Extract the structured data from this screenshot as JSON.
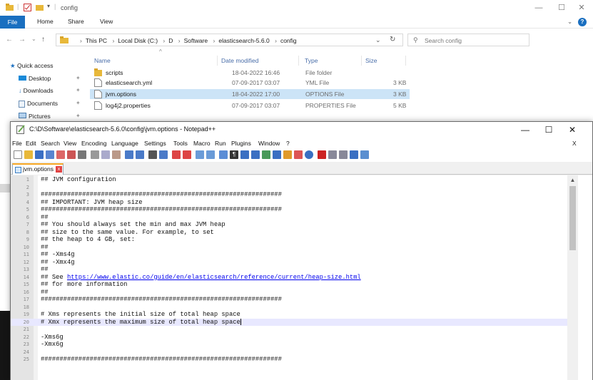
{
  "explorer": {
    "title": "config",
    "ribbon_tabs": [
      "File",
      "Home",
      "Share",
      "View"
    ],
    "breadcrumbs": [
      "This PC",
      "Local Disk (C:)",
      "D",
      "Software",
      "elasticsearch-5.6.0",
      "config"
    ],
    "search_placeholder": "Search config",
    "nav_items": [
      {
        "label": "Quick access",
        "icon": "star-icon"
      },
      {
        "label": "Desktop",
        "icon": "desktop-icon"
      },
      {
        "label": "Downloads",
        "icon": "download-icon"
      },
      {
        "label": "Documents",
        "icon": "documents-icon"
      },
      {
        "label": "Pictures",
        "icon": "pictures-icon"
      }
    ],
    "columns": [
      "Name",
      "Date modified",
      "Type",
      "Size"
    ],
    "files": [
      {
        "name": "scripts",
        "date": "18-04-2022 16:46",
        "type": "File folder",
        "size": "",
        "icon": "folder-icon"
      },
      {
        "name": "elasticsearch.yml",
        "date": "07-09-2017 03:07",
        "type": "YML File",
        "size": "3 KB",
        "icon": "file-icon"
      },
      {
        "name": "jvm.options",
        "date": "18-04-2022 17:00",
        "type": "OPTIONS File",
        "size": "3 KB",
        "icon": "file-icon",
        "selected": true
      },
      {
        "name": "log4j2.properties",
        "date": "07-09-2017 03:07",
        "type": "PROPERTIES File",
        "size": "5 KB",
        "icon": "file-icon"
      }
    ]
  },
  "npp": {
    "title": "C:\\D\\Software\\elasticsearch-5.6.0\\config\\jvm.options - Notepad++",
    "menu": [
      "File",
      "Edit",
      "Search",
      "View",
      "Encoding",
      "Language",
      "Settings",
      "Tools",
      "Macro",
      "Run",
      "Plugins",
      "Window",
      "?"
    ],
    "menu_close": "X",
    "tab_label": "jvm.options",
    "tab_close": "x",
    "link_text": "https://www.elastic.co/guide/en/elasticsearch/reference/current/heap-size.html",
    "lines": [
      {
        "n": "1",
        "text": "## JVM configuration"
      },
      {
        "n": "2",
        "text": ""
      },
      {
        "n": "3",
        "text": "################################################################"
      },
      {
        "n": "4",
        "text": "## IMPORTANT: JVM heap size"
      },
      {
        "n": "5",
        "text": "################################################################"
      },
      {
        "n": "6",
        "text": "##"
      },
      {
        "n": "7",
        "text": "## You should always set the min and max JVM heap"
      },
      {
        "n": "8",
        "text": "## size to the same value. For example, to set"
      },
      {
        "n": "9",
        "text": "## the heap to 4 GB, set:"
      },
      {
        "n": "10",
        "text": "##"
      },
      {
        "n": "11",
        "text": "## -Xms4g"
      },
      {
        "n": "12",
        "text": "## -Xmx4g"
      },
      {
        "n": "13",
        "text": "##"
      },
      {
        "n": "14",
        "text": "## See "
      },
      {
        "n": "15",
        "text": "## for more information"
      },
      {
        "n": "16",
        "text": "##"
      },
      {
        "n": "17",
        "text": "################################################################"
      },
      {
        "n": "18",
        "text": ""
      },
      {
        "n": "19",
        "text": "# Xms represents the initial size of total heap space"
      },
      {
        "n": "20",
        "text": "# Xmx represents the maximum size of total heap space"
      },
      {
        "n": "21",
        "text": ""
      },
      {
        "n": "22",
        "text": "-Xms6g"
      },
      {
        "n": "23",
        "text": "-Xmx6g"
      },
      {
        "n": "24",
        "text": ""
      },
      {
        "n": "25",
        "text": "################################################################"
      }
    ]
  },
  "colors": {
    "accent": "#1a6fc0",
    "selection": "#cce4f7",
    "current_line": "#e8e8ff",
    "link": "#0000ee"
  }
}
